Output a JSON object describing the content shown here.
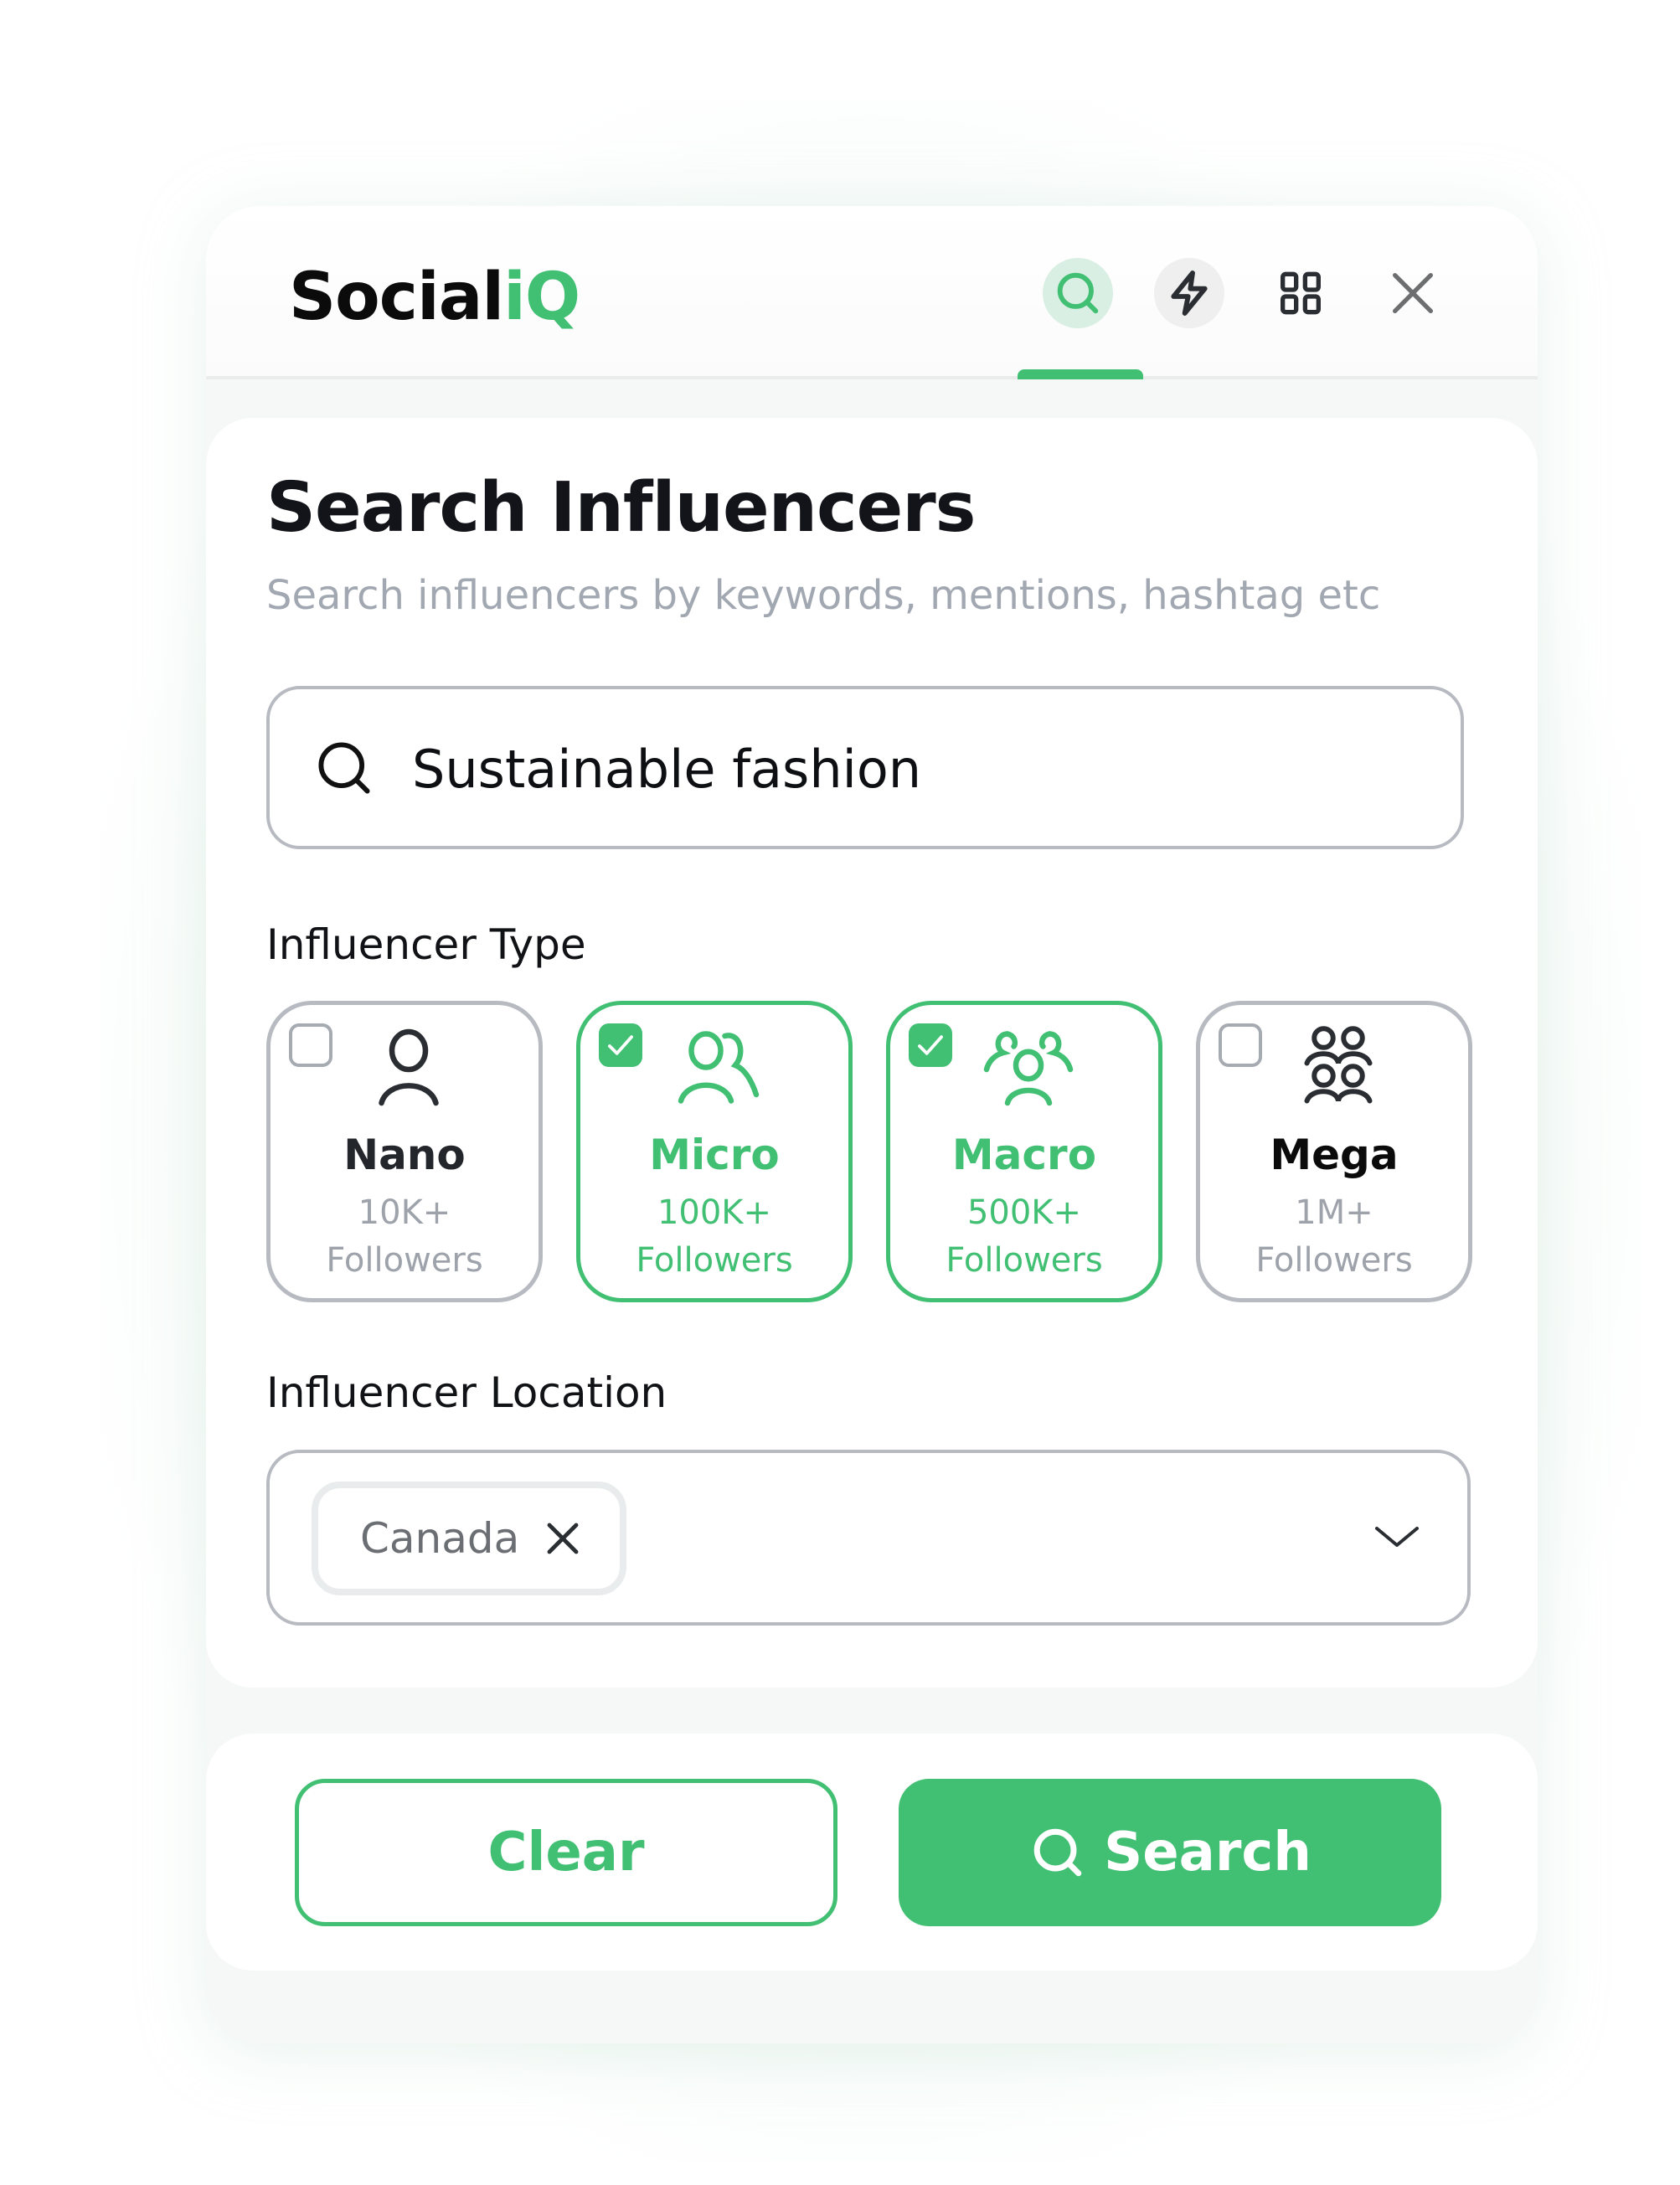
{
  "app": {
    "logo_main": "Social",
    "logo_accent": "iQ"
  },
  "header": {
    "icons": [
      {
        "name": "search-icon",
        "active": true
      },
      {
        "name": "bolt-icon",
        "active": false
      },
      {
        "name": "grid-icon",
        "active": false
      },
      {
        "name": "close-icon",
        "active": false
      }
    ]
  },
  "colors": {
    "accent": "#41bf73",
    "text_dark": "#13141a",
    "muted": "#a2a8b1",
    "border": "#b7bbc1"
  },
  "main": {
    "title": "Search Influencers",
    "subtitle": "Search influencers by keywords, mentions, hashtag etc",
    "search": {
      "value": "Sustainable fashion",
      "placeholder": ""
    },
    "influencer_type": {
      "label": "Influencer Type",
      "options": [
        {
          "name": "Nano",
          "count": "10K+",
          "unit": "Followers",
          "checked": false,
          "icon": "user-icon"
        },
        {
          "name": "Micro",
          "count": "100K+",
          "unit": "Followers",
          "checked": true,
          "icon": "users-icon"
        },
        {
          "name": "Macro",
          "count": "500K+",
          "unit": "Followers",
          "checked": true,
          "icon": "user-group-icon"
        },
        {
          "name": "Mega",
          "count": "1M+",
          "unit": "Followers",
          "checked": false,
          "icon": "users-four-icon"
        }
      ]
    },
    "influencer_location": {
      "label": "Influencer Location",
      "selected": [
        "Canada"
      ]
    }
  },
  "footer": {
    "clear_label": "Clear",
    "search_label": "Search"
  }
}
